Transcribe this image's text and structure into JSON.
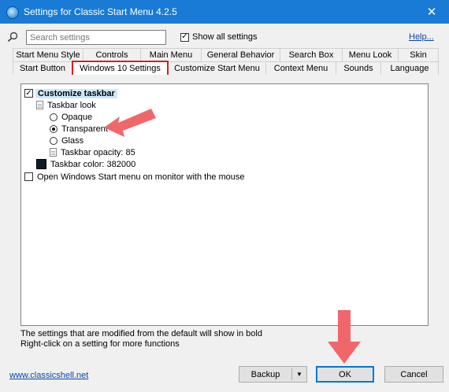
{
  "window": {
    "title": "Settings for Classic Start Menu 4.2.5",
    "close_glyph": "✕"
  },
  "toolbar": {
    "search_placeholder": "Search settings",
    "show_all_label": "Show all settings",
    "show_all_checked": true,
    "help_label": "Help..."
  },
  "tabs": {
    "row1": [
      "Start Menu Style",
      "Controls",
      "Main Menu",
      "General Behavior",
      "Search Box",
      "Menu Look",
      "Skin"
    ],
    "row2": [
      "Start Button",
      "Windows 10 Settings",
      "Customize Start Menu",
      "Context Menu",
      "Sounds",
      "Language"
    ],
    "active": "Windows 10 Settings"
  },
  "tree": {
    "customize_taskbar": "Customize taskbar",
    "taskbar_look": "Taskbar look",
    "opaque": "Opaque",
    "transparent": "Transparent",
    "glass": "Glass",
    "taskbar_opacity": "Taskbar opacity: 85",
    "taskbar_color": "Taskbar color: 382000",
    "open_start_menu": "Open Windows Start menu on monitor with the mouse",
    "selected_look": "Transparent"
  },
  "footer": {
    "note1": "The settings that are modified from the default will show in bold",
    "note2": "Right-click on a setting for more functions",
    "link": "www.classicshell.net",
    "backup_label": "Backup",
    "ok_label": "OK",
    "cancel_label": "Cancel"
  },
  "colors": {
    "titlebar": "#1a7bd6",
    "annotation_arrow": "#f0676b",
    "highlight_border": "#d81e1e",
    "taskbar_swatch": "#0d1b2a"
  }
}
